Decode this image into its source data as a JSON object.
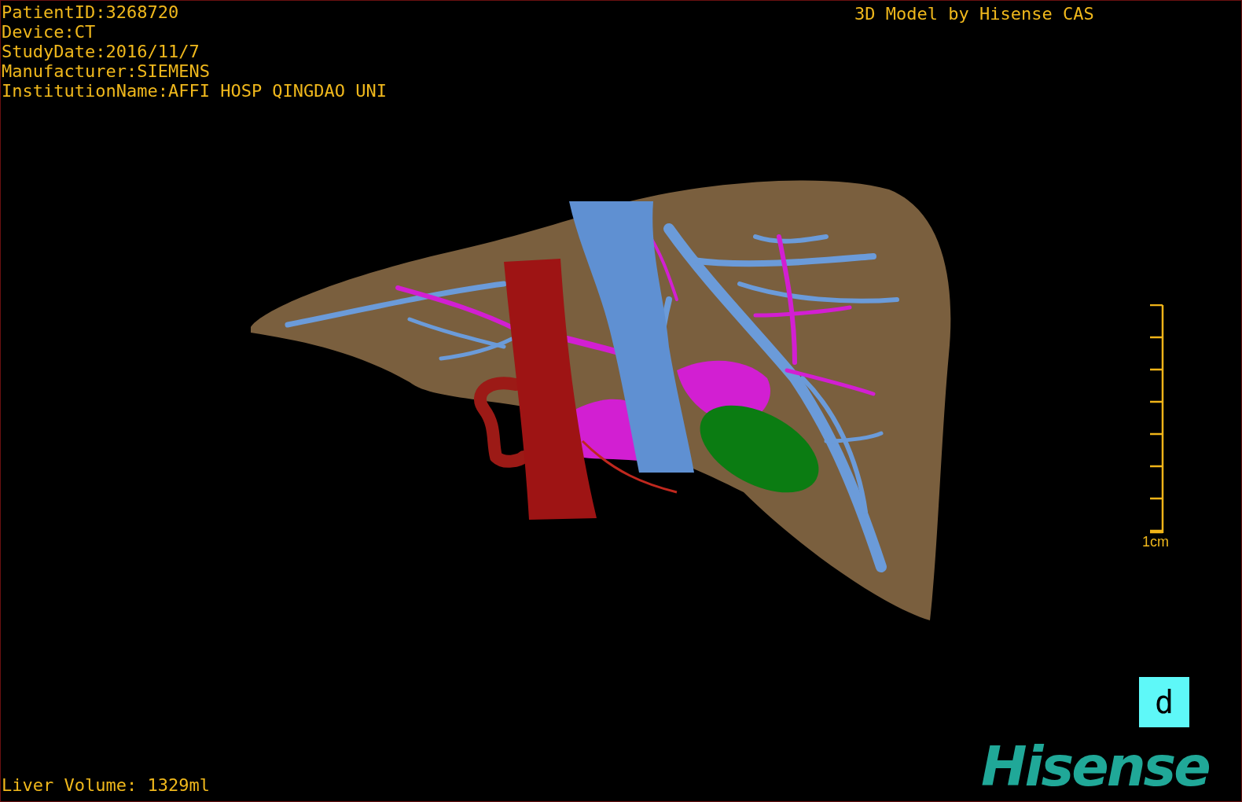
{
  "patient_info": [
    "PatientID:3268720",
    "Device:CT",
    "StudyDate:2016/11/7",
    "Manufacturer:SIEMENS",
    "InstitutionName:AFFI HOSP QINGDAO UNI"
  ],
  "model_credit": "3D Model by Hisense CAS",
  "scale_bar": {
    "label": "1cm"
  },
  "view_button": {
    "label": "d"
  },
  "liver_volume": "Liver Volume: 1329ml",
  "logo": "Hisense"
}
